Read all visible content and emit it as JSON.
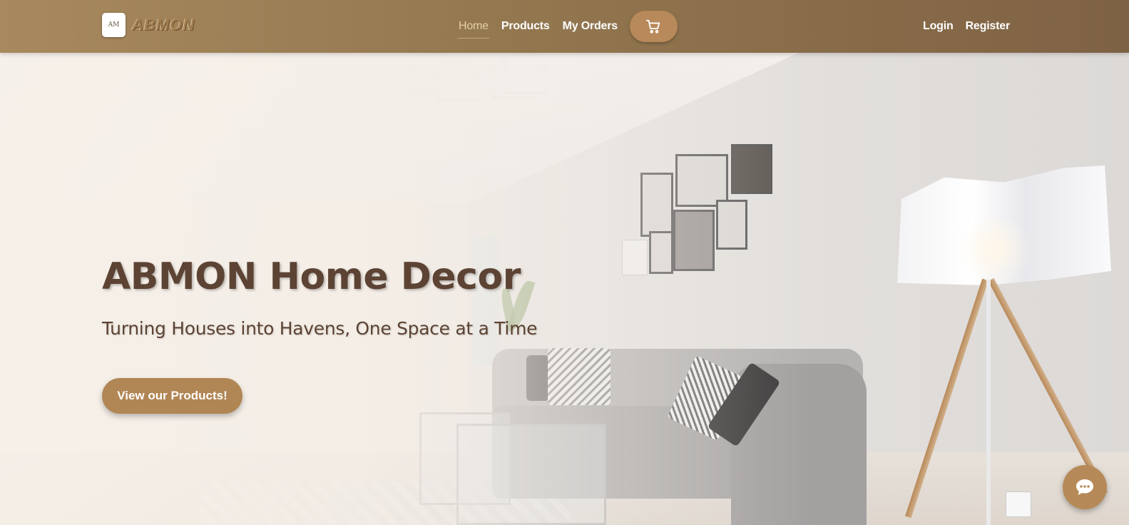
{
  "brand": {
    "logo_mark": "AM",
    "name": "ABMON"
  },
  "nav": {
    "items": [
      {
        "label": "Home",
        "active": true
      },
      {
        "label": "Products",
        "active": false
      },
      {
        "label": "My Orders",
        "active": false
      }
    ],
    "cart_icon": "cart-icon",
    "auth": [
      {
        "label": "Login"
      },
      {
        "label": "Register"
      }
    ]
  },
  "hero": {
    "title": "ABMON Home Decor",
    "subtitle": "Turning Houses into Havens, One Space at a Time",
    "cta_label": "View our Products!"
  },
  "chat": {
    "icon": "chat-bubble-icon"
  },
  "colors": {
    "header_start": "#a8895f",
    "header_end": "#7e6244",
    "accent": "#b18655",
    "title_text": "#5c4333",
    "active_nav": "#e6cfa6"
  }
}
